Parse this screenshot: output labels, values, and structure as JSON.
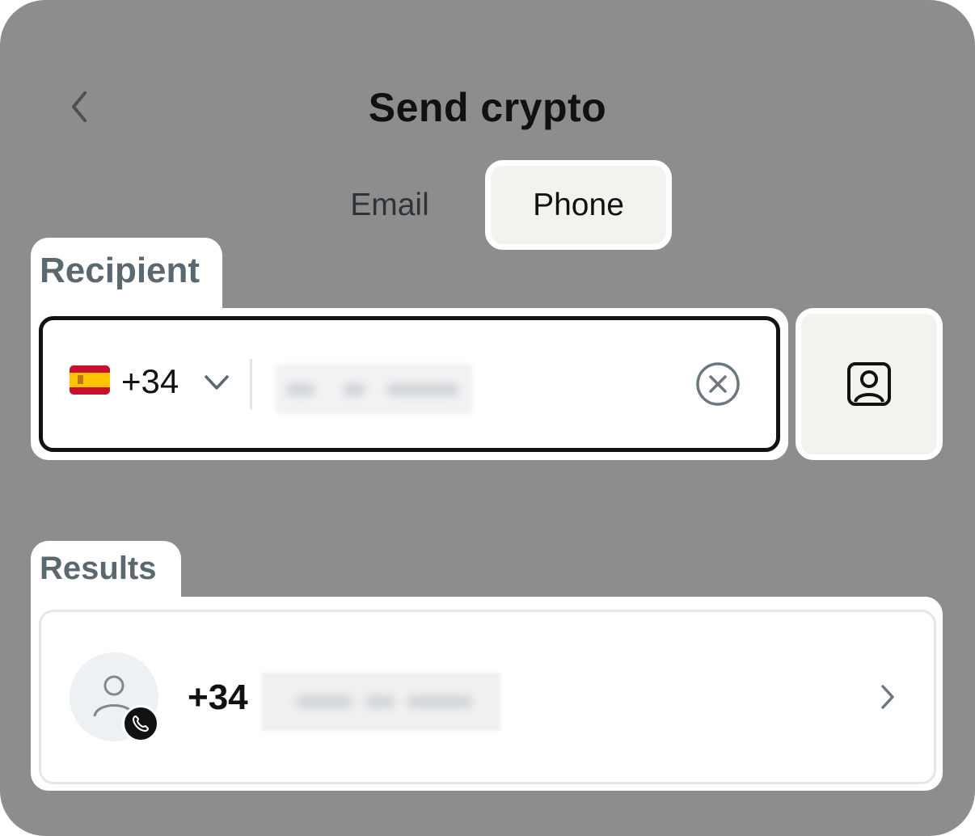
{
  "header": {
    "title": "Send crypto",
    "back_icon": "chevron-left-icon"
  },
  "tabs": [
    {
      "label": "Email",
      "selected": false
    },
    {
      "label": "Phone",
      "selected": true
    }
  ],
  "recipient": {
    "label": "Recipient",
    "country_flag": "spain-flag-icon",
    "country_code": "+34",
    "phone_value_redacted": true,
    "clear_icon": "clear-circle-icon",
    "contacts_icon": "contact-book-icon"
  },
  "results": {
    "label": "Results",
    "items": [
      {
        "country_code": "+34",
        "number_redacted": true,
        "avatar_icon": "person-icon",
        "badge_icon": "phone-icon"
      }
    ]
  },
  "colors": {
    "overlay": "#8d8d8d",
    "selected_tab_bg": "#f3f2ef",
    "label_text": "#5c6870",
    "primary_text": "#111111"
  }
}
